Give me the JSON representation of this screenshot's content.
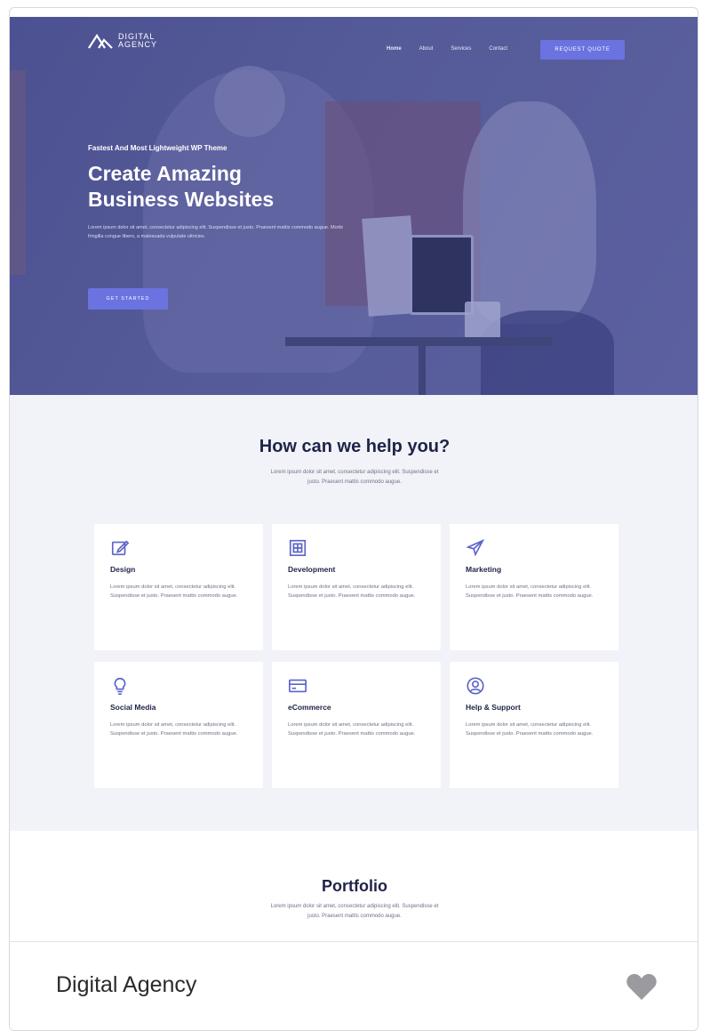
{
  "header": {
    "logo_line1": "DIGITAL",
    "logo_line2": "AGENCY",
    "nav": [
      "Home",
      "About",
      "Services",
      "Contact"
    ],
    "quote_button": "REQUEST QUOTE"
  },
  "hero": {
    "kicker": "Fastest And Most Lightweight WP Theme",
    "title_line1": "Create Amazing",
    "title_line2": "Business Websites",
    "text": "Lorem ipsum dolor sit amet, consectetur adipiscing elit. Suspendisse et justo. Praesent mattis commodo augue. Morbi fringilla congue libero, a malesuada vulputate ultricies.",
    "cta": "GET STARTED"
  },
  "services": {
    "title": "How can we help you?",
    "subtitle_line1": "Lorem ipsum dolor sit amet, consectetur adipiscing elit. Suspendisse et",
    "subtitle_line2": "justo. Praesent mattis commodo augue.",
    "cards": [
      {
        "icon": "edit-icon",
        "title": "Design",
        "text": "Lorem ipsum dolor sit amet, consectetur adipiscing elit. Suspendisse et justo. Praesent mattis commodo augue."
      },
      {
        "icon": "layout-icon",
        "title": "Development",
        "text": "Lorem ipsum dolor sit amet, consectetur adipiscing elit. Suspendisse et justo. Praesent mattis commodo augue."
      },
      {
        "icon": "paper-plane-icon",
        "title": "Marketing",
        "text": "Lorem ipsum dolor sit amet, consectetur adipiscing elit. Suspendisse et justo. Praesent mattis commodo augue."
      },
      {
        "icon": "lightbulb-icon",
        "title": "Social Media",
        "text": "Lorem ipsum dolor sit amet, consectetur adipiscing elit. Suspendisse et justo. Praesent mattis commodo augue."
      },
      {
        "icon": "credit-card-icon",
        "title": "eCommerce",
        "text": "Lorem ipsum dolor sit amet, consectetur adipiscing elit. Suspendisse et justo. Praesent mattis commodo augue."
      },
      {
        "icon": "user-circle-icon",
        "title": "Help & Support",
        "text": "Lorem ipsum dolor sit amet, consectetur adipiscing elit. Suspendisse et justo. Praesent mattis commodo augue."
      }
    ]
  },
  "portfolio": {
    "title": "Portfolio",
    "subtitle_line1": "Lorem ipsum dolor sit amet, consectetur adipiscing elit. Suspendisse et",
    "subtitle_line2": "justo. Praesent mattis commodo augue."
  },
  "footer_bar": {
    "title": "Digital Agency",
    "heart_icon": "heart-icon"
  },
  "colors": {
    "hero_overlay": "#4c5191",
    "accent": "#6b73e0",
    "icon": "#5a63c9",
    "section_bg": "#f1f3f8",
    "heading": "#1f2347"
  }
}
